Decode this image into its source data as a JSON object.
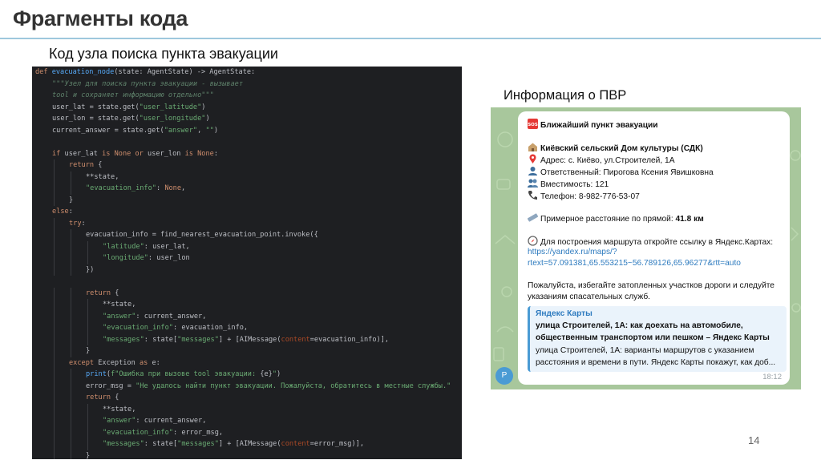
{
  "slide": {
    "title": "Фрагменты кода",
    "subtitle": "Код узла поиска пункта эвакуации",
    "info_heading": "Информация о ПВР",
    "page_number": "14"
  },
  "code": {
    "lines": [
      {
        "indent": 0,
        "tokens": [
          {
            "t": "def ",
            "c": "kw"
          },
          {
            "t": "evacuation_node",
            "c": "fn"
          },
          {
            "t": "(state: AgentState) -> AgentState:",
            "c": "op"
          }
        ]
      },
      {
        "indent": 1,
        "tokens": [
          {
            "t": "\"\"\"Узел для поиска пункта эвакуации - вызывает",
            "c": "doc"
          }
        ]
      },
      {
        "indent": 1,
        "tokens": [
          {
            "t": "tool и сохраняет информацию отдельно\"\"\"",
            "c": "doc"
          }
        ]
      },
      {
        "indent": 1,
        "tokens": [
          {
            "t": "user_lat = state.get(",
            "c": "op"
          },
          {
            "t": "\"user_latitude\"",
            "c": "str"
          },
          {
            "t": ")",
            "c": "op"
          }
        ]
      },
      {
        "indent": 1,
        "tokens": [
          {
            "t": "user_lon = state.get(",
            "c": "op"
          },
          {
            "t": "\"user_longitude\"",
            "c": "str"
          },
          {
            "t": ")",
            "c": "op"
          }
        ]
      },
      {
        "indent": 1,
        "tokens": [
          {
            "t": "current_answer = state.get(",
            "c": "op"
          },
          {
            "t": "\"answer\"",
            "c": "str"
          },
          {
            "t": ", ",
            "c": "op"
          },
          {
            "t": "\"\"",
            "c": "str"
          },
          {
            "t": ")",
            "c": "op"
          }
        ]
      },
      {
        "indent": 0,
        "tokens": []
      },
      {
        "indent": 1,
        "tokens": [
          {
            "t": "if ",
            "c": "kw"
          },
          {
            "t": "user_lat ",
            "c": "op"
          },
          {
            "t": "is None or ",
            "c": "kw"
          },
          {
            "t": "user_lon ",
            "c": "op"
          },
          {
            "t": "is None",
            "c": "kw"
          },
          {
            "t": ":",
            "c": "op"
          }
        ]
      },
      {
        "indent": 2,
        "tokens": [
          {
            "t": "return ",
            "c": "kw"
          },
          {
            "t": "{",
            "c": "op"
          }
        ]
      },
      {
        "indent": 3,
        "tokens": [
          {
            "t": "**state,",
            "c": "op"
          }
        ]
      },
      {
        "indent": 3,
        "tokens": [
          {
            "t": "\"evacuation_info\"",
            "c": "str"
          },
          {
            "t": ": ",
            "c": "op"
          },
          {
            "t": "None",
            "c": "kw"
          },
          {
            "t": ",",
            "c": "op"
          }
        ]
      },
      {
        "indent": 2,
        "tokens": [
          {
            "t": "}",
            "c": "op"
          }
        ]
      },
      {
        "indent": 1,
        "tokens": [
          {
            "t": "else",
            "c": "kw"
          },
          {
            "t": ":",
            "c": "op"
          }
        ]
      },
      {
        "indent": 2,
        "tokens": [
          {
            "t": "try",
            "c": "kw"
          },
          {
            "t": ":",
            "c": "op"
          }
        ]
      },
      {
        "indent": 3,
        "tokens": [
          {
            "t": "evacuation_info = find_nearest_evacuation_point.invoke({",
            "c": "op"
          }
        ]
      },
      {
        "indent": 4,
        "tokens": [
          {
            "t": "\"latitude\"",
            "c": "str"
          },
          {
            "t": ": user_lat,",
            "c": "op"
          }
        ]
      },
      {
        "indent": 4,
        "tokens": [
          {
            "t": "\"longitude\"",
            "c": "str"
          },
          {
            "t": ": user_lon",
            "c": "op"
          }
        ]
      },
      {
        "indent": 3,
        "tokens": [
          {
            "t": "})",
            "c": "op"
          }
        ]
      },
      {
        "indent": 0,
        "tokens": []
      },
      {
        "indent": 3,
        "tokens": [
          {
            "t": "return ",
            "c": "kw"
          },
          {
            "t": "{",
            "c": "op"
          }
        ]
      },
      {
        "indent": 4,
        "tokens": [
          {
            "t": "**state,",
            "c": "op"
          }
        ]
      },
      {
        "indent": 4,
        "tokens": [
          {
            "t": "\"answer\"",
            "c": "str"
          },
          {
            "t": ": current_answer,",
            "c": "op"
          }
        ]
      },
      {
        "indent": 4,
        "tokens": [
          {
            "t": "\"evacuation_info\"",
            "c": "str"
          },
          {
            "t": ": evacuation_info,",
            "c": "op"
          }
        ]
      },
      {
        "indent": 4,
        "tokens": [
          {
            "t": "\"messages\"",
            "c": "str"
          },
          {
            "t": ": state[",
            "c": "op"
          },
          {
            "t": "\"messages\"",
            "c": "str"
          },
          {
            "t": "] + [AIMessage(",
            "c": "op"
          },
          {
            "t": "content",
            "c": "param"
          },
          {
            "t": "=evacuation_info)],",
            "c": "op"
          }
        ]
      },
      {
        "indent": 3,
        "tokens": [
          {
            "t": "}",
            "c": "op"
          }
        ]
      },
      {
        "indent": 2,
        "tokens": [
          {
            "t": "except ",
            "c": "kw"
          },
          {
            "t": "Exception ",
            "c": "op"
          },
          {
            "t": "as ",
            "c": "kw"
          },
          {
            "t": "e:",
            "c": "op"
          }
        ]
      },
      {
        "indent": 3,
        "tokens": [
          {
            "t": "print",
            "c": "fn"
          },
          {
            "t": "(",
            "c": "op"
          },
          {
            "t": "f\"Ошибка при вызове tool эвакуации: ",
            "c": "str"
          },
          {
            "t": "{e}",
            "c": "op"
          },
          {
            "t": "\"",
            "c": "str"
          },
          {
            "t": ")",
            "c": "op"
          }
        ]
      },
      {
        "indent": 3,
        "tokens": [
          {
            "t": "error_msg = ",
            "c": "op"
          },
          {
            "t": "\"Не удалось найти пункт эвакуации. Пожалуйста, обратитесь в местные службы.\"",
            "c": "str"
          }
        ]
      },
      {
        "indent": 3,
        "tokens": [
          {
            "t": "return ",
            "c": "kw"
          },
          {
            "t": "{",
            "c": "op"
          }
        ]
      },
      {
        "indent": 4,
        "tokens": [
          {
            "t": "**state,",
            "c": "op"
          }
        ]
      },
      {
        "indent": 4,
        "tokens": [
          {
            "t": "\"answer\"",
            "c": "str"
          },
          {
            "t": ": current_answer,",
            "c": "op"
          }
        ]
      },
      {
        "indent": 4,
        "tokens": [
          {
            "t": "\"evacuation_info\"",
            "c": "str"
          },
          {
            "t": ": error_msg,",
            "c": "op"
          }
        ]
      },
      {
        "indent": 4,
        "tokens": [
          {
            "t": "\"messages\"",
            "c": "str"
          },
          {
            "t": ": state[",
            "c": "op"
          },
          {
            "t": "\"messages\"",
            "c": "str"
          },
          {
            "t": "] + [AIMessage(",
            "c": "op"
          },
          {
            "t": "content",
            "c": "param"
          },
          {
            "t": "=error_msg)],",
            "c": "op"
          }
        ]
      },
      {
        "indent": 3,
        "tokens": [
          {
            "t": "}",
            "c": "op"
          }
        ]
      }
    ]
  },
  "message": {
    "header": "Ближайший пункт эвакуации",
    "place_name": "Киёвский сельский Дом культуры (СДК)",
    "address": "Адрес: с. Киёво, ул.Строителей, 1А",
    "responsible": "Ответственный: Пирогова Ксения Явишковна",
    "capacity": "Вместимость: 121",
    "phone": "Телефон: 8-982-776-53-07",
    "distance_label": "Примерное расстояние по прямой: ",
    "distance_value": "41.8 км",
    "route_text": "Для построения маршрута откройте ссылку в Яндекс.Картах:",
    "link_line1": "https://yandex.ru/maps/?",
    "link_line2": "rtext=57.091381,65.553215~56.789126,65.96277&rtt=auto",
    "warning_line1": "Пожалуйста, избегайте затопленных участков дороги и следуйте",
    "warning_line2": "указаниям спасательных служб.",
    "preview": {
      "source": "Яндекс Карты",
      "title_line1": "улица Строителей, 1А: как доехать на автомобиле,",
      "title_line2": "общественным транспортом или пешком – Яндекс Карты",
      "desc_line1": "улица Строителей, 1А: варианты маршрутов с указанием",
      "desc_line2": "расстояния и времени в пути. Яндекс Карты покажут, как доб..."
    },
    "time": "18:12",
    "avatar_letter": "Р"
  },
  "icons": [
    "sos-icon",
    "house-icon",
    "pin-icon",
    "person-icon",
    "people-icon",
    "phone-icon",
    "ruler-icon",
    "compass-icon"
  ],
  "colors": {
    "code_bg": "#1e1f22",
    "keyword": "#cf8e6d",
    "function": "#56a8f5",
    "string": "#6aab73",
    "chat_bg": "#a8c79c",
    "link": "#2e7bbf",
    "title_rule": "#9ec8dd"
  }
}
